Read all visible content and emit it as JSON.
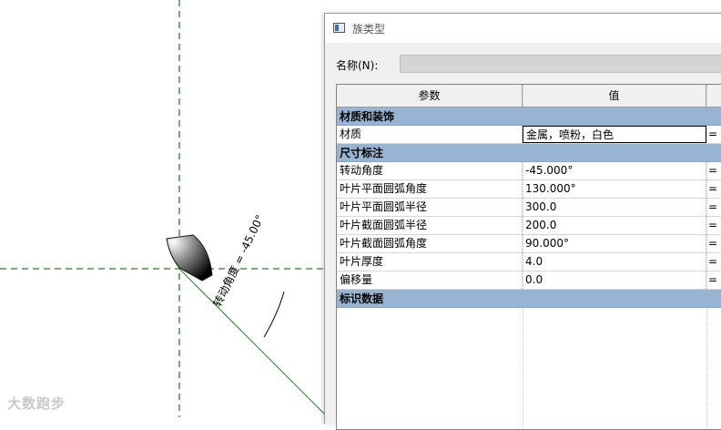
{
  "dialog": {
    "title": "族类型",
    "name_label": "名称(N):",
    "name_value": ""
  },
  "table": {
    "headers": {
      "param": "参数",
      "value": "值",
      "formula": ""
    },
    "groups": [
      {
        "label": "材质和装饰",
        "rows": [
          {
            "param": "材质",
            "value": "金属，喷粉，白色",
            "formula": "="
          }
        ]
      },
      {
        "label": "尺寸标注",
        "rows": [
          {
            "param": "转动角度",
            "value": "-45.000°",
            "formula": "="
          },
          {
            "param": "叶片平面圆弧角度",
            "value": "130.000°",
            "formula": "="
          },
          {
            "param": "叶片平面圆弧半径",
            "value": "300.0",
            "formula": "="
          },
          {
            "param": "叶片截面圆弧半径",
            "value": "200.0",
            "formula": "="
          },
          {
            "param": "叶片截面圆弧角度",
            "value": "90.000°",
            "formula": "="
          },
          {
            "param": "叶片厚度",
            "value": "4.0",
            "formula": "="
          },
          {
            "param": "偏移量",
            "value": "0.0",
            "formula": "="
          }
        ]
      },
      {
        "label": "标识数据",
        "rows": []
      }
    ]
  },
  "drawing": {
    "dimension_text": "转动角度 = -45.00°",
    "watermark": "大数跑步"
  },
  "colors": {
    "ref_line": "#2a7a2a",
    "group_header": "#98b4d2"
  }
}
